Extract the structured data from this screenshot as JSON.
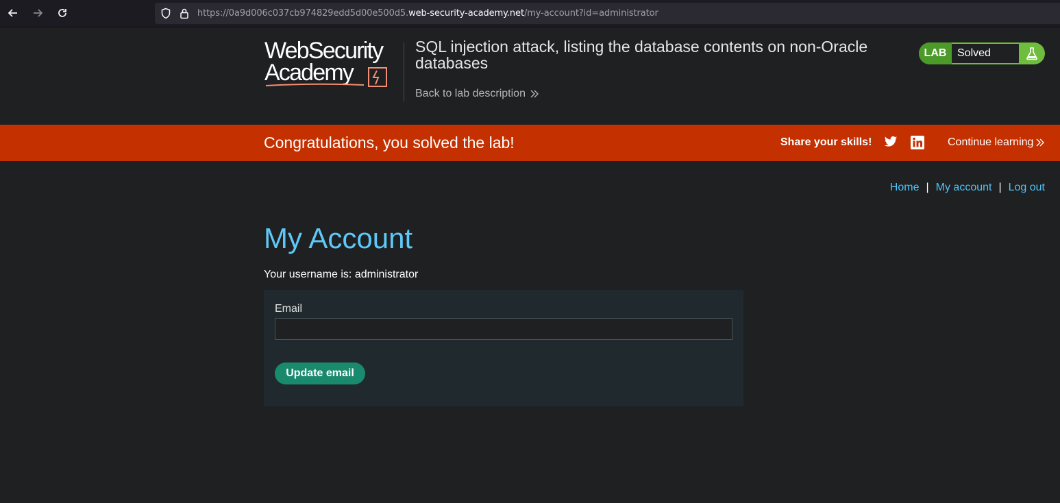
{
  "browser": {
    "back_icon": "arrow-left-icon",
    "forward_icon": "arrow-right-icon",
    "reload_icon": "reload-icon",
    "url_prefix": "https://0a9d006c037cb974829edd5d00e500d5.",
    "url_host": "web-security-academy.net",
    "url_path": "/my-account?id=administrator"
  },
  "header": {
    "logo_line1": "WebSecurity",
    "logo_line2": "Academy",
    "lab_title": "SQL injection attack, listing the database contents on non-Oracle databases",
    "back_link": "Back to lab description",
    "badge_lab": "LAB",
    "badge_status": "Solved"
  },
  "banner": {
    "message": "Congratulations, you solved the lab!",
    "share_label": "Share your skills!",
    "continue_link": "Continue learning"
  },
  "nav": {
    "home": "Home",
    "separator": "|",
    "my_account": "My account",
    "log_out": "Log out"
  },
  "main": {
    "title": "My Account",
    "username_line": "Your username is: administrator",
    "email_label": "Email",
    "email_value": "",
    "update_button": "Update email"
  },
  "colors": {
    "background": "#1f2021",
    "banner": "#c53000",
    "link": "#4fc3f7",
    "title": "#5ec8f8",
    "badge_green": "#6fbd3e",
    "button": "#1a8a6f",
    "form_bg": "#202a2e"
  }
}
